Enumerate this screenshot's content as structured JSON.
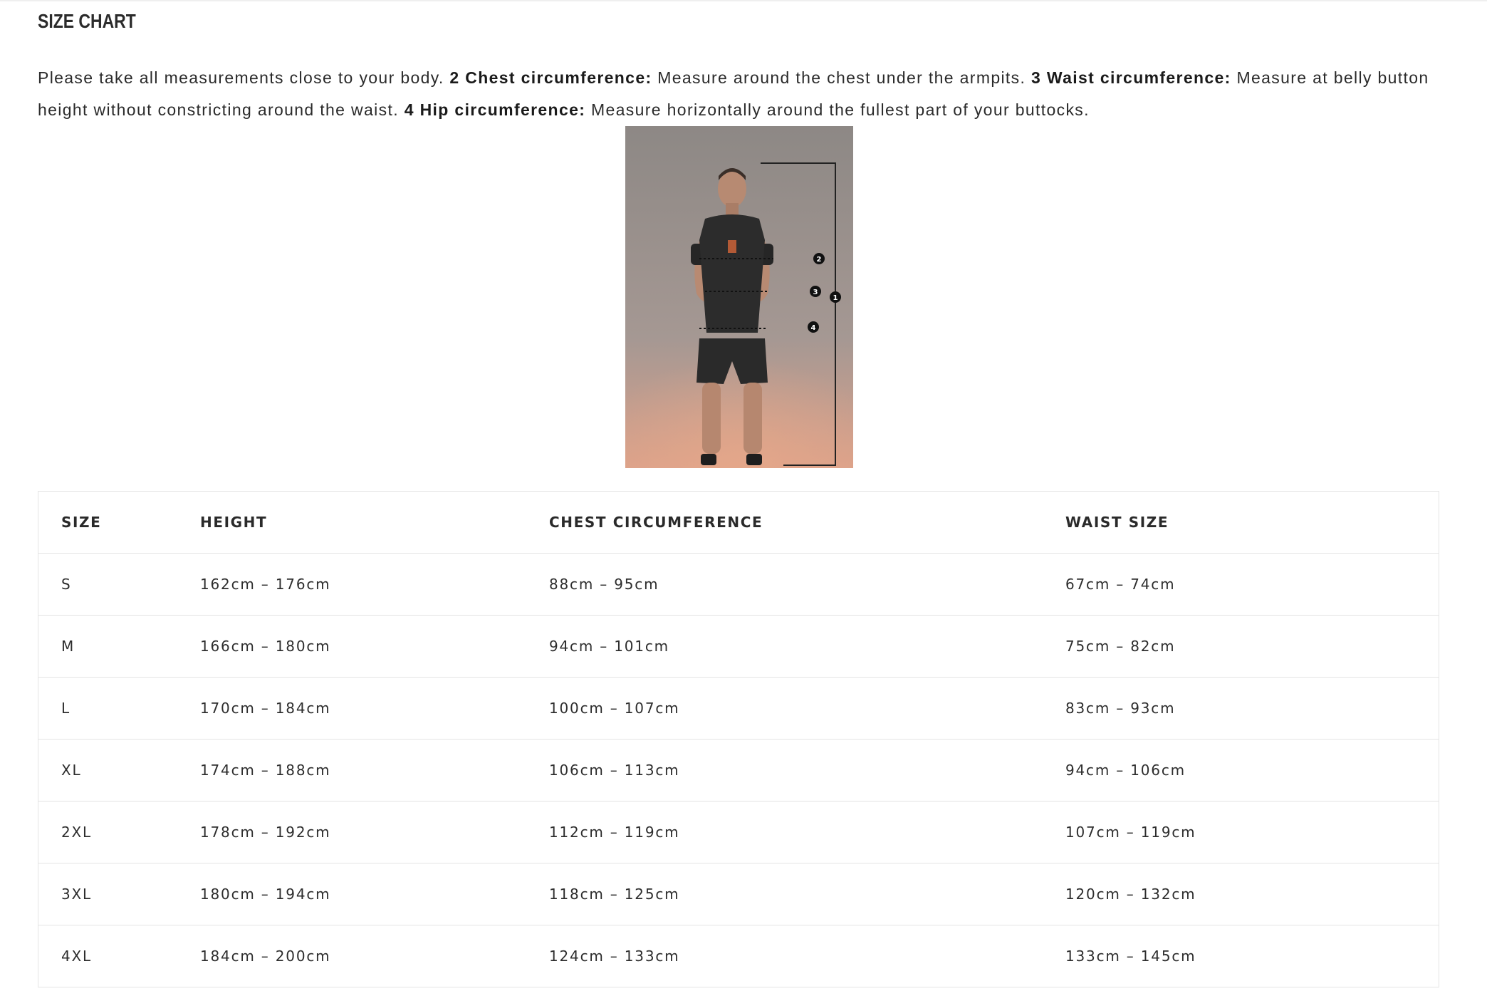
{
  "page": {
    "title": "SIZE CHART"
  },
  "intro": {
    "lead": "Please take all measurements close to your body.",
    "chest_label": "2 Chest circumference:",
    "chest_text": "Measure around the chest under the armpits.",
    "waist_label": "3 Waist circumference:",
    "waist_text": "Measure at belly button height without constricting around the waist.",
    "hip_label": "4 Hip circumference:",
    "hip_text": "Measure horizontally around the fullest part of your buttocks."
  },
  "figure": {
    "markers": [
      "1",
      "2",
      "3",
      "4"
    ],
    "colors": {
      "background_top": "#8f8a87",
      "background_bottom": "#d9a08a",
      "garment": "#2b2b2b",
      "skin": "#b88a72",
      "marker": "#111111"
    }
  },
  "size_table": {
    "headers": [
      "SIZE",
      "HEIGHT",
      "CHEST CIRCUMFERENCE",
      "WAIST SIZE"
    ],
    "rows": [
      [
        "S",
        "162cm – 176cm",
        "88cm – 95cm",
        "67cm – 74cm"
      ],
      [
        "M",
        "166cm – 180cm",
        "94cm – 101cm",
        "75cm – 82cm"
      ],
      [
        "L",
        "170cm – 184cm",
        "100cm – 107cm",
        "83cm – 93cm"
      ],
      [
        "XL",
        "174cm – 188cm",
        "106cm – 113cm",
        "94cm – 106cm"
      ],
      [
        "2XL",
        "178cm – 192cm",
        "112cm – 119cm",
        "107cm – 119cm"
      ],
      [
        "3XL",
        "180cm – 194cm",
        "118cm – 125cm",
        "120cm – 132cm"
      ],
      [
        "4XL",
        "184cm – 200cm",
        "124cm – 133cm",
        "133cm – 145cm"
      ]
    ]
  }
}
